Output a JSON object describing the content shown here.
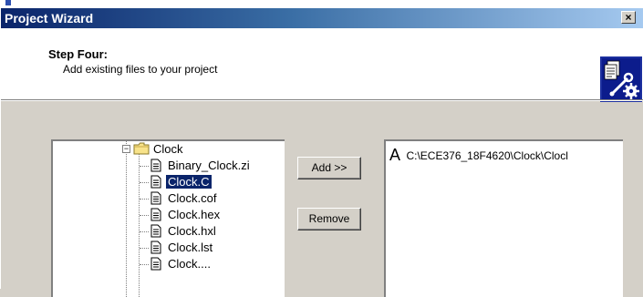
{
  "window": {
    "title": "Project Wizard",
    "close_label": "×"
  },
  "header": {
    "step_title": "Step Four:",
    "step_subtitle": "Add existing files to your project",
    "icon": "wizard-document-wrench-icon"
  },
  "tree": {
    "folder": {
      "label": "Clock",
      "expander": "−",
      "icon": "folder-icon"
    },
    "files": [
      {
        "label": "Binary_Clock.zi",
        "selected": false,
        "icon": "file-icon"
      },
      {
        "label": "Clock.C",
        "selected": true,
        "icon": "file-icon"
      },
      {
        "label": "Clock.cof",
        "selected": false,
        "icon": "file-icon"
      },
      {
        "label": "Clock.hex",
        "selected": false,
        "icon": "file-icon"
      },
      {
        "label": "Clock.hxl",
        "selected": false,
        "icon": "file-icon"
      },
      {
        "label": "Clock.lst",
        "selected": false,
        "icon": "file-icon"
      },
      {
        "label": "Clock....",
        "selected": false,
        "icon": "file-icon"
      }
    ],
    "scroll_up_icon": "scroll-up-arrow-icon"
  },
  "actions": {
    "add_label": "Add >>",
    "remove_label": "Remove"
  },
  "added_files": [
    {
      "letter": "A",
      "path": "C:\\ECE376_18F4620\\Clock\\Clocl"
    }
  ],
  "colors": {
    "selection": "#0a246a",
    "title_gradient_start": "#0a246a",
    "title_gradient_end": "#a6caf0",
    "dialog_face": "#d4d0c8"
  }
}
